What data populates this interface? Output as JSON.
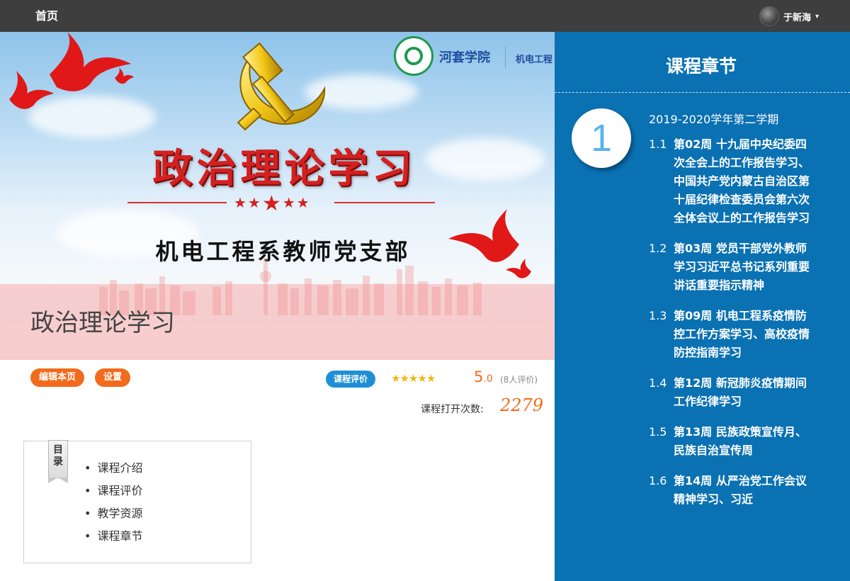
{
  "topbar": {
    "home_label": "首页",
    "user_name": "于新海"
  },
  "banner": {
    "logo_text": "河套学院",
    "logo_text_2": "机电工程",
    "title": "政治理论学习",
    "subtitle": "机电工程系教师党支部",
    "course_title": "政治理论学习"
  },
  "actions": {
    "edit_label": "编辑本页",
    "settings_label": "设置",
    "rating_label": "课程评价",
    "rating_stars": 5,
    "score_main": "5",
    "score_decimal": ".0",
    "rating_count": "(8人评价)",
    "open_label": "课程打开次数:",
    "open_count": "2279"
  },
  "toc": {
    "tag": "目录",
    "items": [
      "课程介绍",
      "课程评价",
      "教学资源",
      "课程章节"
    ]
  },
  "chapters": {
    "title": "课程章节",
    "chapter_number": "1",
    "semester": "2019-2020学年第二学期",
    "sections": [
      {
        "num": "1.1",
        "title": "第02周 十九届中央纪委四次全会上的工作报告学习、中国共产党内蒙古自治区第十届纪律检查委员会第六次全体会议上的工作报告学习"
      },
      {
        "num": "1.2",
        "title": "第03周 党员干部党外教师 学习习近平总书记系列重要讲话重要指示精神"
      },
      {
        "num": "1.3",
        "title": "第09周 机电工程系疫情防控工作方案学习、高校疫情防控指南学习"
      },
      {
        "num": "1.4",
        "title": "第12周 新冠肺炎疫情期间工作纪律学习"
      },
      {
        "num": "1.5",
        "title": "第13周 民族政策宣传月、民族自治宣传周"
      },
      {
        "num": "1.6",
        "title": "第14周 从严治党工作会议精神学习、习近"
      }
    ]
  },
  "colors": {
    "topbar_bg": "#3e3e3e",
    "panel_bg": "#0a71b3",
    "accent_orange": "#f26b1d",
    "badge_blue": "#1e8fd6",
    "banner_red": "#d42020",
    "star_gold": "#f1b717"
  },
  "icons": [
    "avatar",
    "chevron-down-icon",
    "party-emblem-icon",
    "dove-icon",
    "star-icon",
    "college-logo-icon"
  ]
}
